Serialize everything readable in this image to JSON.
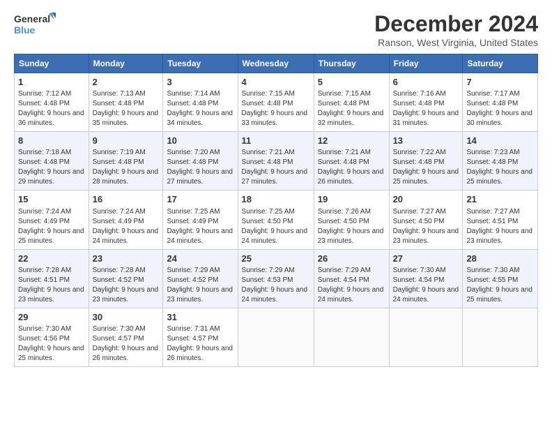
{
  "logo": {
    "line1": "General",
    "line2": "Blue"
  },
  "title": "December 2024",
  "subtitle": "Ranson, West Virginia, United States",
  "days_of_week": [
    "Sunday",
    "Monday",
    "Tuesday",
    "Wednesday",
    "Thursday",
    "Friday",
    "Saturday"
  ],
  "weeks": [
    [
      {
        "day": "1",
        "sunrise": "7:12 AM",
        "sunset": "4:48 PM",
        "daylight": "9 hours and 36 minutes."
      },
      {
        "day": "2",
        "sunrise": "7:13 AM",
        "sunset": "4:48 PM",
        "daylight": "9 hours and 35 minutes."
      },
      {
        "day": "3",
        "sunrise": "7:14 AM",
        "sunset": "4:48 PM",
        "daylight": "9 hours and 34 minutes."
      },
      {
        "day": "4",
        "sunrise": "7:15 AM",
        "sunset": "4:48 PM",
        "daylight": "9 hours and 33 minutes."
      },
      {
        "day": "5",
        "sunrise": "7:15 AM",
        "sunset": "4:48 PM",
        "daylight": "9 hours and 32 minutes."
      },
      {
        "day": "6",
        "sunrise": "7:16 AM",
        "sunset": "4:48 PM",
        "daylight": "9 hours and 31 minutes."
      },
      {
        "day": "7",
        "sunrise": "7:17 AM",
        "sunset": "4:48 PM",
        "daylight": "9 hours and 30 minutes."
      }
    ],
    [
      {
        "day": "8",
        "sunrise": "7:18 AM",
        "sunset": "4:48 PM",
        "daylight": "9 hours and 29 minutes."
      },
      {
        "day": "9",
        "sunrise": "7:19 AM",
        "sunset": "4:48 PM",
        "daylight": "9 hours and 28 minutes."
      },
      {
        "day": "10",
        "sunrise": "7:20 AM",
        "sunset": "4:48 PM",
        "daylight": "9 hours and 27 minutes."
      },
      {
        "day": "11",
        "sunrise": "7:21 AM",
        "sunset": "4:48 PM",
        "daylight": "9 hours and 27 minutes."
      },
      {
        "day": "12",
        "sunrise": "7:21 AM",
        "sunset": "4:48 PM",
        "daylight": "9 hours and 26 minutes."
      },
      {
        "day": "13",
        "sunrise": "7:22 AM",
        "sunset": "4:48 PM",
        "daylight": "9 hours and 25 minutes."
      },
      {
        "day": "14",
        "sunrise": "7:23 AM",
        "sunset": "4:48 PM",
        "daylight": "9 hours and 25 minutes."
      }
    ],
    [
      {
        "day": "15",
        "sunrise": "7:24 AM",
        "sunset": "4:49 PM",
        "daylight": "9 hours and 25 minutes."
      },
      {
        "day": "16",
        "sunrise": "7:24 AM",
        "sunset": "4:49 PM",
        "daylight": "9 hours and 24 minutes."
      },
      {
        "day": "17",
        "sunrise": "7:25 AM",
        "sunset": "4:49 PM",
        "daylight": "9 hours and 24 minutes."
      },
      {
        "day": "18",
        "sunrise": "7:25 AM",
        "sunset": "4:50 PM",
        "daylight": "9 hours and 24 minutes."
      },
      {
        "day": "19",
        "sunrise": "7:26 AM",
        "sunset": "4:50 PM",
        "daylight": "9 hours and 23 minutes."
      },
      {
        "day": "20",
        "sunrise": "7:27 AM",
        "sunset": "4:50 PM",
        "daylight": "9 hours and 23 minutes."
      },
      {
        "day": "21",
        "sunrise": "7:27 AM",
        "sunset": "4:51 PM",
        "daylight": "9 hours and 23 minutes."
      }
    ],
    [
      {
        "day": "22",
        "sunrise": "7:28 AM",
        "sunset": "4:51 PM",
        "daylight": "9 hours and 23 minutes."
      },
      {
        "day": "23",
        "sunrise": "7:28 AM",
        "sunset": "4:52 PM",
        "daylight": "9 hours and 23 minutes."
      },
      {
        "day": "24",
        "sunrise": "7:29 AM",
        "sunset": "4:52 PM",
        "daylight": "9 hours and 23 minutes."
      },
      {
        "day": "25",
        "sunrise": "7:29 AM",
        "sunset": "4:53 PM",
        "daylight": "9 hours and 24 minutes."
      },
      {
        "day": "26",
        "sunrise": "7:29 AM",
        "sunset": "4:54 PM",
        "daylight": "9 hours and 24 minutes."
      },
      {
        "day": "27",
        "sunrise": "7:30 AM",
        "sunset": "4:54 PM",
        "daylight": "9 hours and 24 minutes."
      },
      {
        "day": "28",
        "sunrise": "7:30 AM",
        "sunset": "4:55 PM",
        "daylight": "9 hours and 25 minutes."
      }
    ],
    [
      {
        "day": "29",
        "sunrise": "7:30 AM",
        "sunset": "4:56 PM",
        "daylight": "9 hours and 25 minutes."
      },
      {
        "day": "30",
        "sunrise": "7:30 AM",
        "sunset": "4:57 PM",
        "daylight": "9 hours and 26 minutes."
      },
      {
        "day": "31",
        "sunrise": "7:31 AM",
        "sunset": "4:57 PM",
        "daylight": "9 hours and 26 minutes."
      },
      null,
      null,
      null,
      null
    ]
  ],
  "labels": {
    "sunrise": "Sunrise:",
    "sunset": "Sunset:",
    "daylight": "Daylight:"
  }
}
